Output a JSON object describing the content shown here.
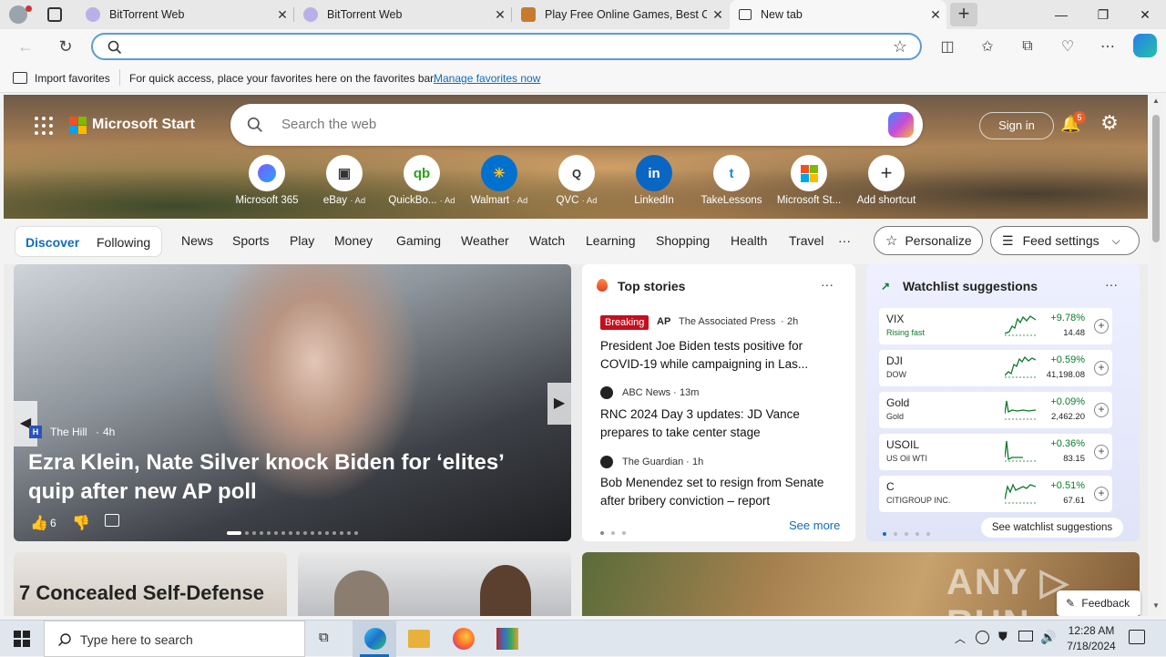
{
  "browser": {
    "tabs": [
      {
        "title": "BitTorrent Web",
        "active": false
      },
      {
        "title": "BitTorrent Web",
        "active": false
      },
      {
        "title": "Play Free Online Games, Best Onl",
        "active": false
      },
      {
        "title": "New tab",
        "active": true
      }
    ],
    "new_tab_symbol": "+",
    "favorites_bar": {
      "import_label": "Import favorites",
      "hint_text": "For quick access, place your favorites here on the favorites bar.",
      "manage_link": "Manage favorites now"
    }
  },
  "msn": {
    "brand": "Microsoft Start",
    "search_placeholder": "Search the web",
    "sign_in": "Sign in",
    "notification_count": "5",
    "shortcuts": [
      {
        "label": "Microsoft 365",
        "ad": ""
      },
      {
        "label": "eBay",
        "ad": "· Ad"
      },
      {
        "label": "QuickBo...",
        "ad": "· Ad"
      },
      {
        "label": "Walmart",
        "ad": "· Ad"
      },
      {
        "label": "QVC",
        "ad": "· Ad"
      },
      {
        "label": "LinkedIn",
        "ad": ""
      },
      {
        "label": "TakeLessons",
        "ad": ""
      },
      {
        "label": "Microsoft St...",
        "ad": ""
      },
      {
        "label": "Add shortcut",
        "ad": ""
      }
    ],
    "nav": {
      "discover": "Discover",
      "following": "Following",
      "links": [
        "News",
        "Sports",
        "Play",
        "Money",
        "Gaming",
        "Weather",
        "Watch",
        "Learning",
        "Shopping",
        "Health",
        "Travel"
      ],
      "more": "···",
      "personalize": "Personalize",
      "feed_settings": "Feed settings"
    },
    "hero_story": {
      "source": "The Hill",
      "age": "4h",
      "headline": "Ezra Klein, Nate Silver knock Biden for ‘elites’ quip after new AP poll",
      "likes": "6"
    },
    "top_stories": {
      "title": "Top stories",
      "items": [
        {
          "badge": "Breaking",
          "source": "The Associated Press",
          "age": "2h",
          "headline": "President Joe Biden tests positive for COVID-19 while campaigning in Las..."
        },
        {
          "badge": "",
          "source": "ABC News",
          "age": "13m",
          "headline": "RNC 2024 Day 3 updates: JD Vance prepares to take center stage"
        },
        {
          "badge": "",
          "source": "The Guardian",
          "age": "1h",
          "headline": "Bob Menendez set to resign from Senate after bribery conviction – report"
        }
      ],
      "see_more": "See more"
    },
    "watchlist": {
      "title": "Watchlist suggestions",
      "stocks": [
        {
          "symbol": "VIX",
          "name": "Rising fast",
          "change": "+9.78%",
          "price": "14.48"
        },
        {
          "symbol": "DJI",
          "name": "DOW",
          "change": "+0.59%",
          "price": "41,198.08"
        },
        {
          "symbol": "Gold",
          "name": "Gold",
          "change": "+0.09%",
          "price": "2,462.20"
        },
        {
          "symbol": "USOIL",
          "name": "US Oil WTI",
          "change": "+0.36%",
          "price": "83.15"
        },
        {
          "symbol": "C",
          "name": "CITIGROUP INC.",
          "change": "+0.51%",
          "price": "67.61"
        }
      ],
      "see_all": "See watchlist suggestions"
    },
    "bottom_cards": {
      "card1_headline": "7 Concealed Self-Defense"
    },
    "feedback": "Feedback"
  },
  "taskbar": {
    "search_placeholder": "Type here to search",
    "time": "12:28 AM",
    "date": "7/18/2024"
  },
  "colors": {
    "accent": "#0f6cbd",
    "breaking": "#c50f1f",
    "positive": "#0b7a2a"
  }
}
